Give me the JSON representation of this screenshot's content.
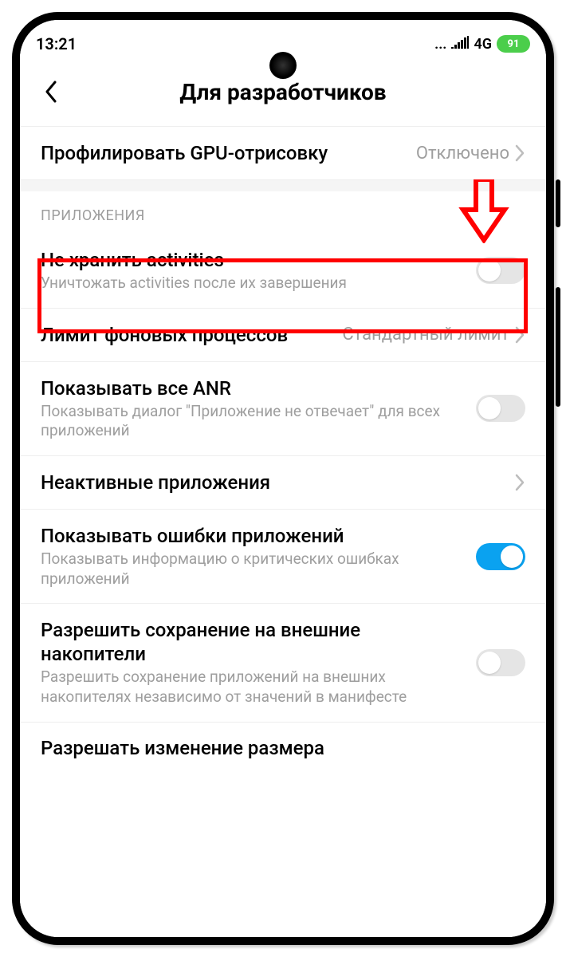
{
  "status": {
    "time": "13:21",
    "signal": "4G",
    "battery": "91"
  },
  "header": {
    "title": "Для разработчиков"
  },
  "rows": {
    "gpu": {
      "title": "Профилировать GPU-отрисовку",
      "value": "Отключено"
    },
    "sectionApps": "ПРИЛОЖЕНИЯ",
    "activities": {
      "title": "Не хранить activities",
      "subtitle": "Уничтожать activities после их завершения"
    },
    "bgLimit": {
      "title": "Лимит фоновых процессов",
      "value": "Стандартный лимит"
    },
    "anr": {
      "title": "Показывать все ANR",
      "subtitle": "Показывать диалог \"Приложение не отвечает\" для всех приложений"
    },
    "inactive": {
      "title": "Неактивные приложения"
    },
    "appErrors": {
      "title": "Показывать ошибки приложений",
      "subtitle": "Показывать информацию о критических ошибках приложений"
    },
    "external": {
      "title": "Разрешить сохранение на внешние накопители",
      "subtitle": "Разрешить сохранение приложений на внешних накопителях независимо от значений в манифесте"
    },
    "resize": {
      "title": "Разрешать изменение размера"
    }
  }
}
